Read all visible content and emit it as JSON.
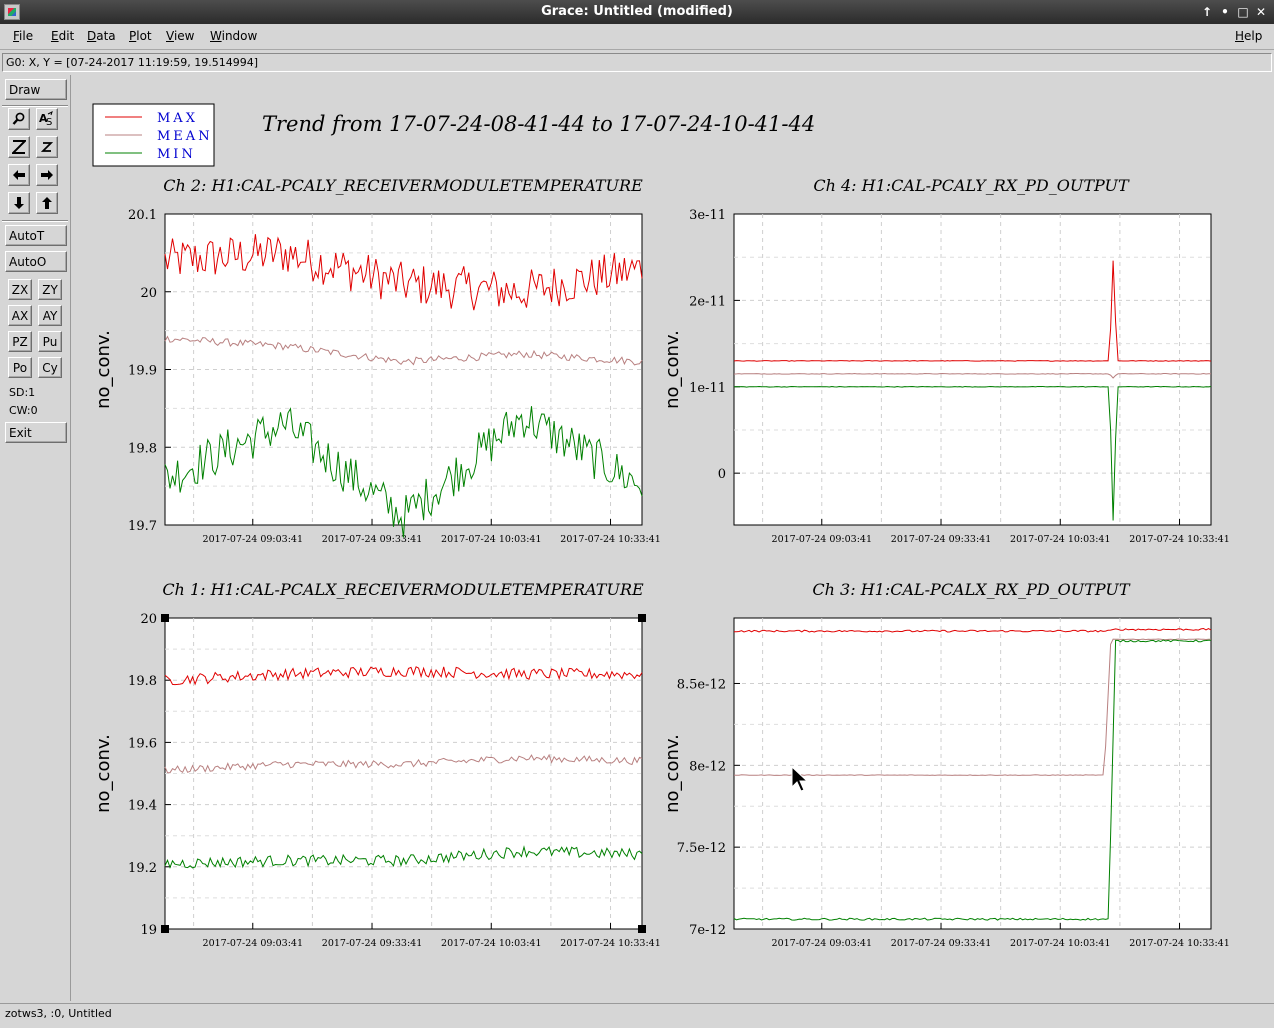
{
  "window": {
    "title": "Grace: Untitled (modified)",
    "controls": [
      "↑",
      "•",
      "□",
      "✕"
    ]
  },
  "menu": {
    "file": "File",
    "edit": "Edit",
    "data": "Data",
    "plot": "Plot",
    "view": "View",
    "window": "Window",
    "help": "Help"
  },
  "locator": "G0: X, Y = [07-24-2017 11:19:59, 19.514994]",
  "toolbar": {
    "draw": "Draw",
    "autot": "AutoT",
    "autoo": "AutoO",
    "zx": "ZX",
    "zy": "ZY",
    "ax": "AX",
    "ay": "AY",
    "pz": "PZ",
    "pu": "Pu",
    "po": "Po",
    "cy": "Cy",
    "sd": "SD:1",
    "cw": "CW:0",
    "exit": "Exit"
  },
  "status": "zotws3, :0, Untitled",
  "chart_data": [
    {
      "type": "line",
      "page_title": "Trend from 17-07-24-08-41-44 to 17-07-24-10-41-44",
      "legend": [
        "MAX",
        "MEAN",
        "MIN"
      ],
      "legend_colors": [
        "#e00000",
        "#b88080",
        "#008000"
      ],
      "title": "Ch 2: H1:CAL-PCALY_RECEIVERMODULETEMPERATURE",
      "ylabel": "no_conv.",
      "ylim": [
        19.7,
        20.1
      ],
      "yticks": [
        "19.7",
        "19.8",
        "19.9",
        "20",
        "20.1"
      ],
      "xticks": [
        "2017-07-24 09:03:41",
        "2017-07-24 09:33:41",
        "2017-07-24 10:03:41",
        "2017-07-24 10:33:41"
      ],
      "series": [
        {
          "name": "MAX",
          "levels": [
            20.04,
            20.05,
            20.01,
            20.0,
            20.03
          ]
        },
        {
          "name": "MEAN",
          "levels": [
            19.94,
            19.93,
            19.91,
            19.92,
            19.91
          ]
        },
        {
          "name": "MIN",
          "levels": [
            19.76,
            19.83,
            19.71,
            19.84,
            19.75
          ]
        }
      ]
    },
    {
      "type": "line",
      "title": "Ch 4: H1:CAL-PCALY_RX_PD_OUTPUT",
      "ylabel": "no_conv.",
      "ylim": [
        -6e-12,
        3e-11
      ],
      "yticks": [
        "0",
        "1e-11",
        "2e-11",
        "3e-11"
      ],
      "xticks": [
        "2017-07-24 09:03:41",
        "2017-07-24 09:33:41",
        "2017-07-24 10:03:41",
        "2017-07-24 10:33:41"
      ],
      "series": [
        {
          "name": "MAX",
          "baseline": 1.3e-11,
          "spike": 2.5e-11
        },
        {
          "name": "MEAN",
          "baseline": 1.15e-11,
          "spike": 1.1e-11
        },
        {
          "name": "MIN",
          "baseline": 1e-11,
          "spike": -6e-12
        }
      ]
    },
    {
      "type": "line",
      "title": "Ch 1: H1:CAL-PCALX_RECEIVERMODULETEMPERATURE",
      "ylabel": "no_conv.",
      "ylim": [
        19.0,
        20.0
      ],
      "yticks": [
        "19",
        "19.2",
        "19.4",
        "19.6",
        "19.8",
        "20"
      ],
      "xticks": [
        "2017-07-24 09:03:41",
        "2017-07-24 09:33:41",
        "2017-07-24 10:03:41",
        "2017-07-24 10:33:41"
      ],
      "series": [
        {
          "name": "MAX",
          "levels": [
            19.8,
            19.82,
            19.83,
            19.82,
            19.82
          ]
        },
        {
          "name": "MEAN",
          "levels": [
            19.51,
            19.53,
            19.53,
            19.55,
            19.54
          ]
        },
        {
          "name": "MIN",
          "levels": [
            19.21,
            19.22,
            19.22,
            19.25,
            19.24
          ]
        }
      ]
    },
    {
      "type": "line",
      "title": "Ch 3: H1:CAL-PCALX_RX_PD_OUTPUT",
      "ylabel": "no_conv.",
      "ylim": [
        7e-12,
        8.9e-12
      ],
      "yticks": [
        "7e-12",
        "7.5e-12",
        "8e-12",
        "8.5e-12"
      ],
      "xticks": [
        "2017-07-24 09:03:41",
        "2017-07-24 09:33:41",
        "2017-07-24 10:03:41",
        "2017-07-24 10:33:41"
      ],
      "series": [
        {
          "name": "MAX",
          "before": 8.82e-12,
          "after": 8.83e-12
        },
        {
          "name": "MEAN",
          "before": 7.94e-12,
          "after": 8.77e-12
        },
        {
          "name": "MIN",
          "before": 7.06e-12,
          "after": 8.76e-12
        }
      ]
    }
  ]
}
